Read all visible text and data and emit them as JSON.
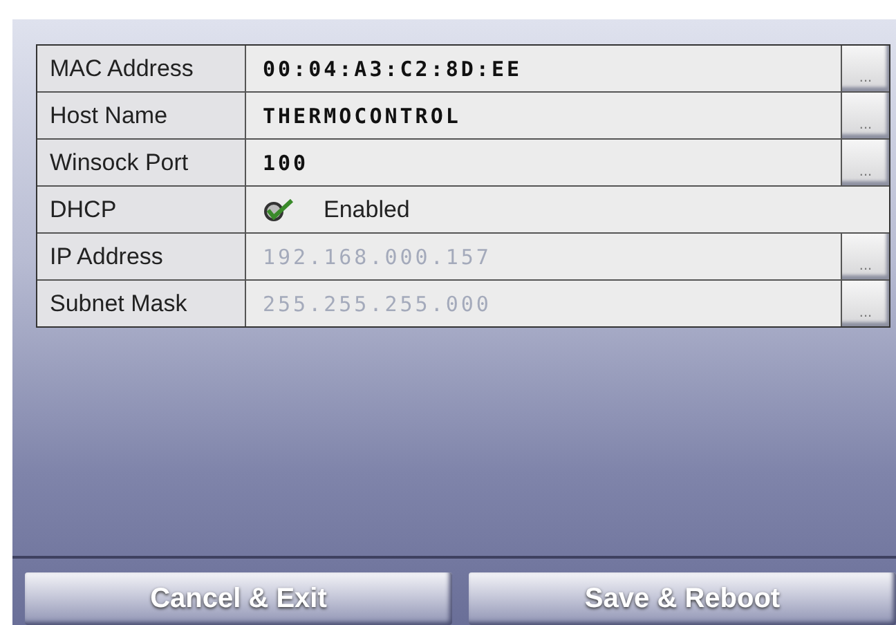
{
  "settings": [
    {
      "kind": "text",
      "label": "MAC Address",
      "value": "00:04:A3:C2:8D:EE",
      "disabled": false,
      "button": "..."
    },
    {
      "kind": "text",
      "label": "Host Name",
      "value": "THERMOCONTROL",
      "disabled": false,
      "button": "..."
    },
    {
      "kind": "text",
      "label": "Winsock Port",
      "value": "100",
      "disabled": false,
      "button": "..."
    },
    {
      "kind": "checkbox",
      "label": "DHCP",
      "value": "Enabled",
      "checked": true
    },
    {
      "kind": "text",
      "label": "IP Address",
      "value": "192.168.000.157",
      "disabled": true,
      "button": "..."
    },
    {
      "kind": "text",
      "label": "Subnet Mask",
      "value": "255.255.255.000",
      "disabled": true,
      "button": "..."
    }
  ],
  "buttons": [
    "Cancel & Exit",
    "Save & Reboot"
  ]
}
